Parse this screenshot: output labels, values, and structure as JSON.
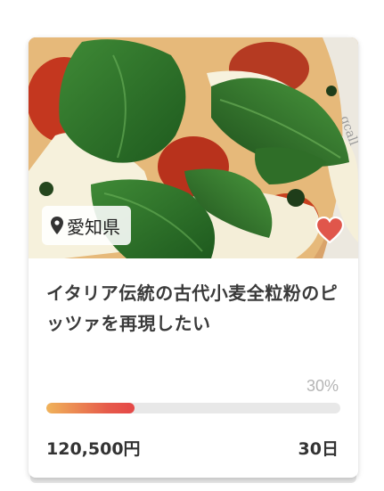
{
  "project": {
    "location": "愛知県",
    "title": "イタリア伝統の古代小麦全粒粉のピッツァを再現したい",
    "progress_percent": 30,
    "progress_label": "30%",
    "amount": "120,500円",
    "days_left": "30日",
    "favorite": false
  },
  "icons": {
    "location": "location-pin-icon",
    "favorite": "heart-icon"
  },
  "colors": {
    "heart": "#e0564b",
    "progress_start": "#f0b35a",
    "progress_end": "#e54848",
    "progress_track": "#e8e8e8",
    "percent_text": "#b5b5b5"
  }
}
